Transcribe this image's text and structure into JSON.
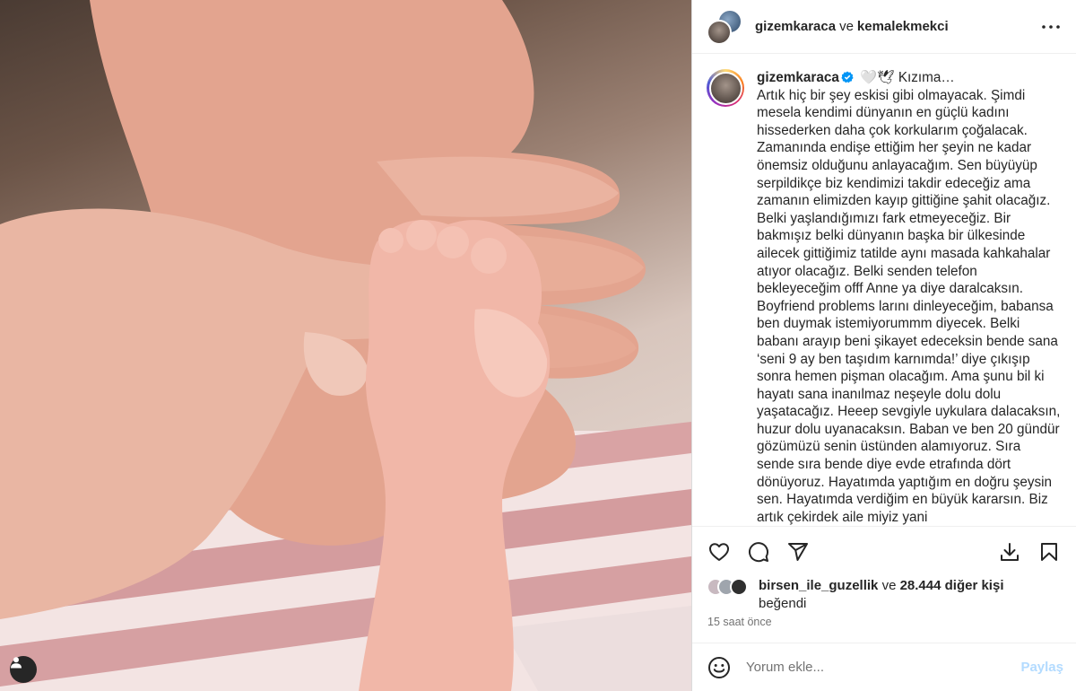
{
  "header": {
    "user1": "gizemkaraca",
    "conjunction": "ve",
    "user2": "kemalekmekci"
  },
  "caption": {
    "username": "gizemkaraca",
    "emoji": "🤍🕊",
    "body": "Kızıma…\nArtık hiç bir şey eskisi gibi olmayacak. Şimdi mesela kendimi dünyanın en güçlü kadını hissederken daha çok korkularım çoğalacak. Zamanında endişe ettiğim her şeyin ne kadar önemsiz olduğunu anlayacağım. Sen büyüyüp serpildikçe biz kendimizi takdir edeceğiz ama zamanın elimizden kayıp gittiğine şahit olacağız. Belki yaşlandığımızı fark etmeyeceğiz. Bir bakmışız belki dünyanın başka bir ülkesinde ailecek gittiğimiz tatilde aynı masada kahkahalar atıyor olacağız. Belki senden telefon bekleyeceğim offf Anne ya diye daralcaksın. Boyfriend problems larını dinleyeceğim, babansa ben duymak istemiyorummm diyecek. Belki babanı arayıp beni şikayet edeceksin bende sana ‘seni 9 ay ben taşıdım karnımda!’ diye çıkışıp sonra hemen pişman olacağım. Ama şunu bil ki hayatı sana inanılmaz neşeyle dolu dolu yaşatacağız. Heeep sevgiyle uykulara dalacaksın, huzur dolu uyanacaksın. Baban ve ben 20 gündür gözümüzü senin üstünden alamıyoruz. Sıra sende sıra bende diye evde etrafında dört dönüyoruz. Hayatımda yaptığım en doğru şeysin sen. Hayatımda verdiğim en büyük kararsın. Biz artık çekirdek aile miyiz yani"
  },
  "likes": {
    "liker": "birsen_ile_guzellik",
    "conjunction": "ve",
    "others": "28.444 diğer kişi",
    "suffix": "beğendi"
  },
  "timestamp": "15 saat önce",
  "comment": {
    "placeholder": "Yorum ekle...",
    "post_label": "Paylaş"
  },
  "colors": {
    "verified": "#0095f6",
    "post_disabled": "#b3dbff",
    "text": "#262626",
    "muted": "#737373"
  },
  "icons": [
    "more-icon",
    "heart-icon",
    "comment-icon",
    "share-icon",
    "download-icon",
    "bookmark-icon",
    "emoji-icon",
    "user-tag-icon",
    "verified-badge-icon"
  ]
}
